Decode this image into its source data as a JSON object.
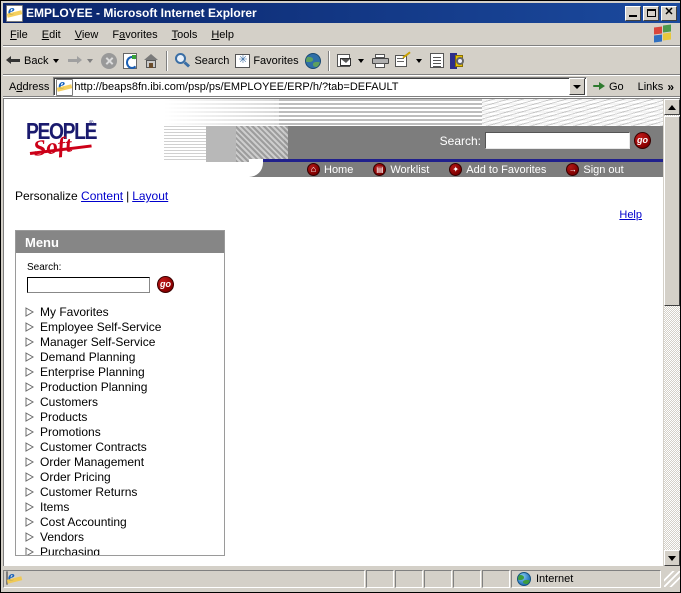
{
  "window": {
    "title": "EMPLOYEE - Microsoft Internet Explorer",
    "minimize_label": "Minimize",
    "maximize_label": "Maximize",
    "close_label": "Close"
  },
  "menubar": {
    "items": [
      {
        "label": "File",
        "accel": "F"
      },
      {
        "label": "Edit",
        "accel": "E"
      },
      {
        "label": "View",
        "accel": "V"
      },
      {
        "label": "Favorites",
        "accel": "a"
      },
      {
        "label": "Tools",
        "accel": "T"
      },
      {
        "label": "Help",
        "accel": "H"
      }
    ]
  },
  "toolbar": {
    "back_label": "Back",
    "forward_label": "",
    "stop_label": "Stop",
    "refresh_label": "Refresh",
    "home_label": "Home",
    "search_label": "Search",
    "favorites_label": "Favorites",
    "history_label": "History",
    "mail_label": "Mail",
    "print_label": "Print",
    "edit_label": "Edit",
    "discuss_label": "Discuss",
    "messenger_label": "Messenger"
  },
  "address": {
    "label": "Address",
    "url": "http://beaps8fn.ibi.com/psp/ps/EMPLOYEE/ERP/h/?tab=DEFAULT",
    "go_label": "Go",
    "links_label": "Links",
    "chevron": "»"
  },
  "page": {
    "logo": {
      "people": "PEOPLE",
      "soft": "Soft",
      "tm": "®"
    },
    "search": {
      "label": "Search:",
      "value": "",
      "go_label": "go"
    },
    "nav": [
      {
        "label": "Home",
        "icon": "home-icon",
        "glyph": "⌂"
      },
      {
        "label": "Worklist",
        "icon": "worklist-icon",
        "glyph": "▤"
      },
      {
        "label": "Add to Favorites",
        "icon": "add-favorites-icon",
        "glyph": "✦"
      },
      {
        "label": "Sign out",
        "icon": "sign-out-icon",
        "glyph": "→"
      }
    ],
    "personalize": {
      "prefix": "Personalize",
      "content_link": "Content",
      "separator": "|",
      "layout_link": "Layout"
    },
    "help_link": "Help"
  },
  "menu_pagelet": {
    "title": "Menu",
    "search_label": "Search:",
    "search_value": "",
    "search_placeholder": "",
    "go_label": "go",
    "items": [
      "My Favorites",
      "Employee Self-Service",
      "Manager Self-Service",
      "Demand Planning",
      "Enterprise Planning",
      "Production Planning",
      "Customers",
      "Products",
      "Promotions",
      "Customer Contracts",
      "Order Management",
      "Order Pricing",
      "Customer Returns",
      "Items",
      "Cost Accounting",
      "Vendors",
      "Purchasing"
    ]
  },
  "statusbar": {
    "message": "",
    "zone": "Internet"
  },
  "colors": {
    "titlebar_blue": "#0a246a",
    "chrome_gray": "#d4d0c8",
    "banner_gray": "#7d7d7d",
    "pagelet_header": "#868686",
    "link_blue": "#0000cc",
    "logo_navy": "#1a1a6e",
    "logo_red": "#cc0018",
    "nav_rule_blue": "#20208c"
  }
}
